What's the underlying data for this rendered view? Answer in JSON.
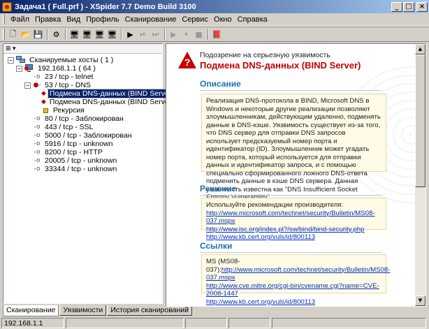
{
  "window": {
    "title": "Задача1 ( Full.prf ) - XSpider 7.7 Demo Build 3100",
    "buttons": {
      "minimize": "_",
      "maximize": "□",
      "close": "×"
    }
  },
  "menu": [
    "Файл",
    "Правка",
    "Вид",
    "Профиль",
    "Сканирование",
    "Сервис",
    "Окно",
    "Справка"
  ],
  "toolbar": {
    "buttons": [
      {
        "name": "new-icon",
        "glyph": "🗋"
      },
      {
        "name": "open-icon",
        "glyph": "📂"
      },
      {
        "name": "save-icon",
        "glyph": "💾"
      },
      {
        "name": "scan-icon",
        "glyph": "⚙"
      },
      {
        "name": "add-host-icon",
        "glyph": "🖥"
      },
      {
        "name": "add-range-icon",
        "glyph": "🖥"
      },
      {
        "name": "edit-host-icon",
        "glyph": "🖥"
      },
      {
        "name": "remove-host-icon",
        "glyph": "🖥"
      },
      {
        "name": "start-scan-icon",
        "glyph": "▶"
      },
      {
        "name": "step-icon",
        "glyph": "⏯"
      },
      {
        "name": "skip-icon",
        "glyph": "⏭"
      },
      {
        "name": "play-icon",
        "glyph": "▶"
      },
      {
        "name": "pause-icon",
        "glyph": "⏸"
      },
      {
        "name": "stop-icon",
        "glyph": "■"
      },
      {
        "name": "report-icon",
        "glyph": "📕"
      }
    ]
  },
  "tree": {
    "root": "Сканируемые хосты ( 1 )",
    "host": "192.168.1.1 ( 64 )",
    "items": [
      {
        "label": "23 / tcp - telnet",
        "type": "port"
      },
      {
        "label": "53 / tcp - DNS",
        "type": "port-vuln"
      },
      {
        "label": "Подмена DNS-данных (BIND Server)",
        "type": "vuln",
        "selected": true
      },
      {
        "label": "Подмена DNS-данных (BIND Server)",
        "type": "vuln"
      },
      {
        "label": "Рекурсия",
        "type": "info"
      },
      {
        "label": "80 / tcp - Заблокирован",
        "type": "port-blocked"
      },
      {
        "label": "443 / tcp - SSL",
        "type": "port"
      },
      {
        "label": "5000 / tcp - Заблокирован",
        "type": "port-blocked"
      },
      {
        "label": "5916 / tcp - unknown",
        "type": "port"
      },
      {
        "label": "8200 / tcp - HTTP",
        "type": "port"
      },
      {
        "label": "20005 / tcp - unknown",
        "type": "port"
      },
      {
        "label": "33344 / tcp - unknown",
        "type": "port"
      }
    ]
  },
  "tabs": [
    "Сканирование",
    "Уязвимости",
    "История сканирований"
  ],
  "detail": {
    "subtitle": "Подозрение на серьезную уязвимость",
    "title": "Подмена DNS-данных (BIND Server)",
    "description_heading": "Описание",
    "description": "Реализация DNS-протокола в BIND, Microsoft DNS в Windows и некоторые другие реализации позволяют злоумышленникам, действующим удаленно, подменять данные в DNS-кэше. Уязвимость существует из-за того, что DNS сервер для отправки DNS запросов использует предсказуемый номер порта и идентификатор (ID). Злоумышленник может угадать номер порта, который используется для отправки данных и идентификатор запроса, и с помощью специально сформированного ложного DNS-ответа подменить данные в кэше DNS сервера. Данная уязвимость известна как \"DNS Insufficient Socket Entropy Vulnerability\".",
    "solution_heading": "Решение",
    "solution_text": "Используйте рекомендации производителя:",
    "solution_links": [
      "http://www.microsoft.com/technet/security/Bulletin/MS08-037.mspx",
      "http://www.isc.org/index.pl?/sw/bind/bind-security.php",
      "http://www.kb.cert.org/vuls/id/800113"
    ],
    "links_heading": "Ссылки",
    "links_prefix": "MS (MS08-037):",
    "links": [
      "http://www.microsoft.com/technet/security/Bulletin/MS08-037.mspx",
      "http://www.cve.mitre.org/cgi-bin/cvename.cgi?name=CVE-2008-1447",
      "http://www.kb.cert.org/vuls/id/800113"
    ]
  },
  "status": {
    "address": "192.168.1.1"
  }
}
